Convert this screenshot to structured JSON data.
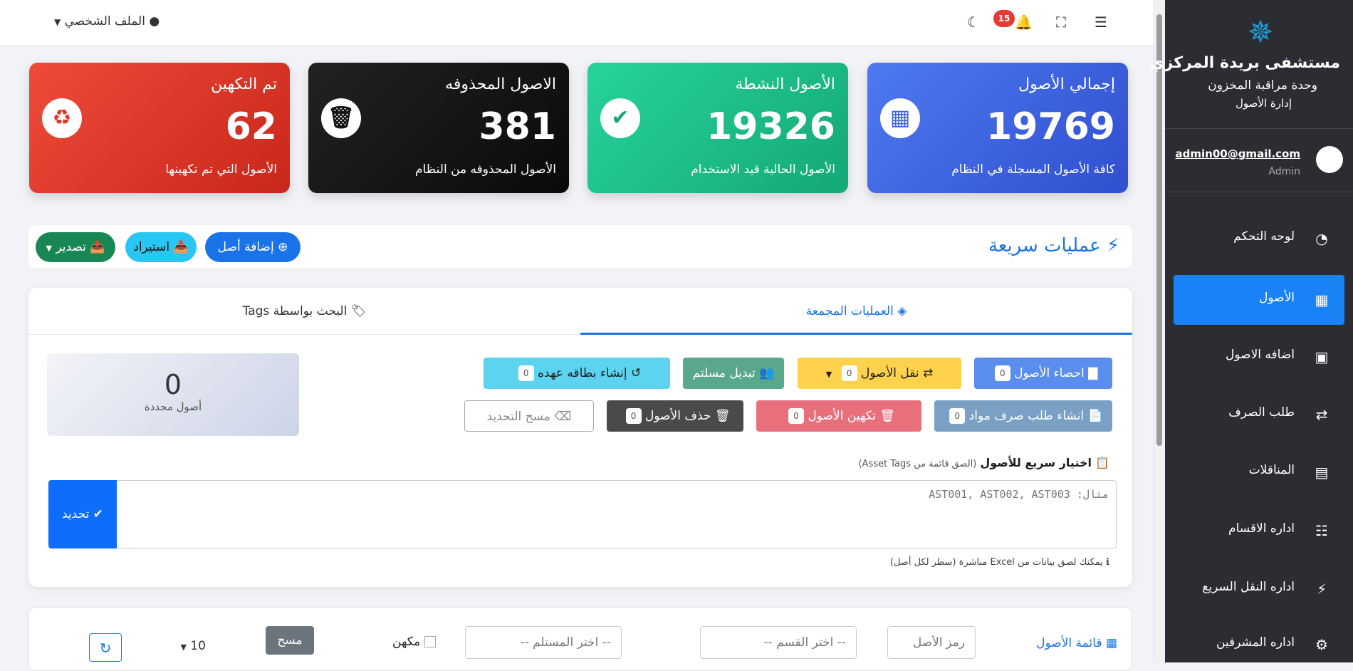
{
  "colors": {
    "accent": "#1a82f7",
    "sidebar_bg": "#2b2d32",
    "card_blue": "#3f64e0",
    "card_green": "#1ec48c",
    "card_black": "#151515",
    "card_red": "#e23a2c"
  },
  "topbar": {
    "profile_label": "الملف الشخصي",
    "notifications_count": "15"
  },
  "sidebar": {
    "brand_title": "مستشفى بريدة المركزي",
    "brand_sub": "وحدة مراقبة المخزون",
    "brand_sub2": "إدارة الأصول",
    "user_email": "admin00@gmail.com",
    "user_role": "Admin",
    "items": [
      {
        "label": "لوحه التحكم",
        "icon": "gauge-icon"
      },
      {
        "label": "الأصول",
        "icon": "boxes-icon",
        "active": true
      },
      {
        "label": "اضافه الاصول",
        "icon": "box-open-icon"
      },
      {
        "label": "طلب الصرف",
        "icon": "exchange-icon"
      },
      {
        "label": "المناقلات",
        "icon": "dolly-icon"
      },
      {
        "label": "اداره الاقسام",
        "icon": "sitemap-icon"
      },
      {
        "label": "اداره النقل السريع",
        "icon": "bolt-icon"
      },
      {
        "label": "اداره المشرفين",
        "icon": "user-gear-icon"
      }
    ]
  },
  "cards": [
    {
      "title": "إجمالي الأصول",
      "value": "19769",
      "desc": "كافة الأصول المسجلة في النظام"
    },
    {
      "title": "الأصول النشطة",
      "value": "19326",
      "desc": "الأصول الحالية قيد الاستخدام"
    },
    {
      "title": "الاصول المحذوفه",
      "value": "381",
      "desc": "الأصول المحذوفه من النظام"
    },
    {
      "title": "تم التكهين",
      "value": "62",
      "desc": "الأصول التي تم تكهينها"
    }
  ],
  "quick": {
    "title": "عمليات سريعة",
    "add": "إضافة أصل",
    "import": "استيراد",
    "export": "تصدير"
  },
  "tabs": {
    "bulk": "العمليات المجمعة",
    "tags": "البحث بواسطة Tags"
  },
  "bulk": {
    "count_all": "0",
    "stats": "احصاء الأصول",
    "move": "نقل الأصول",
    "change_receiver": "تبديل مسلتم",
    "custody_card": "إنشاء بطاقه عهده",
    "material_request": "انشاء طلب صرف مواد",
    "scrap": "تكهين الأصول",
    "delete": "حذف الأصول",
    "clear": "مسح التحديد",
    "selected_count": "0",
    "selected_label": "أصول محددة"
  },
  "quick_select": {
    "title": "اختيار سريع للأصول",
    "hint": "(الصق قائمة من Asset Tags)",
    "placeholder": "مثال: AST001, AST002, AST003",
    "select_btn": "تحديد",
    "note": "يمكنك لصق بيانات من Excel مباشرة (سطر لكل أصل)"
  },
  "list": {
    "title": "قائمة الأصول",
    "tag_placeholder": "رمز الأصل",
    "dept": "-- اختر القسم --",
    "receiver": "-- اختر المستلم --",
    "scrapped": "مكهن",
    "clear": "مسح",
    "per_page": "10"
  }
}
